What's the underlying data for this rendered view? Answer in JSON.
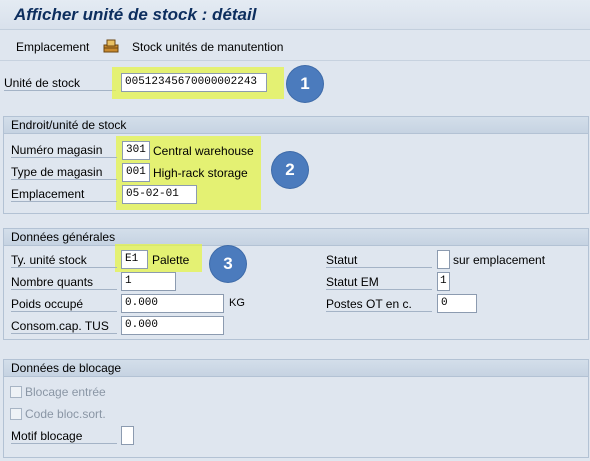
{
  "window": {
    "title": "Afficher unité de stock : détail"
  },
  "toolbar": {
    "emplacement_label": "Emplacement",
    "stock_label": "Stock unités de manutention",
    "icon": "stock-handling-units-icon"
  },
  "header": {
    "unite_label": "Unité de stock",
    "unite_value": "00512345670000002243"
  },
  "groups": {
    "endroit": {
      "title": "Endroit/unité de stock",
      "numero_magasin_label": "Numéro magasin",
      "numero_magasin_value": "301",
      "numero_magasin_text": "Central warehouse",
      "type_magasin_label": "Type de magasin",
      "type_magasin_value": "001",
      "type_magasin_text": "High-rack storage",
      "emplacement_label": "Emplacement",
      "emplacement_value": "05-02-01"
    },
    "generales": {
      "title": "Données générales",
      "ty_unite_label": "Ty. unité stock",
      "ty_unite_value": "E1",
      "ty_unite_text": "Palette",
      "nombre_quants_label": "Nombre quants",
      "nombre_quants_value": "1",
      "poids_label": "Poids occupé",
      "poids_value": "0.000",
      "poids_unit": "KG",
      "consom_label": "Consom.cap. TUS",
      "consom_value": "0.000",
      "statut_label": "Statut",
      "statut_text": "sur emplacement",
      "statut_em_label": "Statut EM",
      "statut_em_value": "1",
      "postes_label": "Postes OT en c.",
      "postes_value": "0"
    },
    "blocage": {
      "title": "Données de blocage",
      "blocage_entree_label": "Blocage entrée",
      "code_bloc_label": "Code bloc.sort.",
      "motif_label": "Motif blocage"
    }
  },
  "badges": [
    "1",
    "2",
    "3"
  ],
  "colors": {
    "highlight": "#e6f44a",
    "badge": "#4b7bbd",
    "title": "#0d2e5e"
  }
}
